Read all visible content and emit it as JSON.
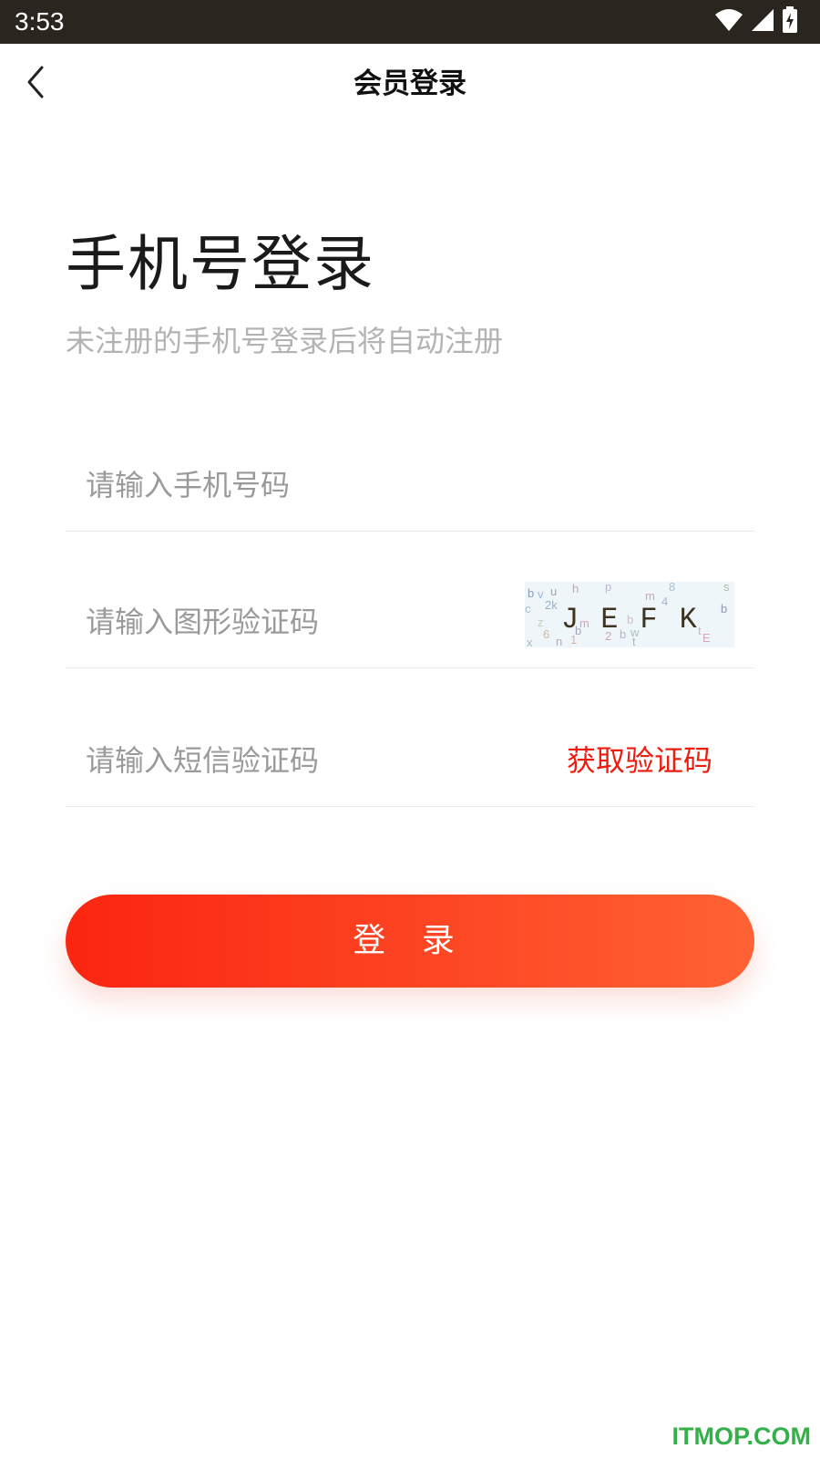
{
  "status_bar": {
    "time": "3:53",
    "icons": [
      "wifi-icon",
      "cellular-signal-icon",
      "battery-charging-icon"
    ]
  },
  "nav": {
    "back_icon": "chevron-left-icon",
    "title": "会员登录"
  },
  "heading": {
    "title": "手机号登录",
    "subtitle": "未注册的手机号登录后将自动注册"
  },
  "form": {
    "phone": {
      "placeholder": "请输入手机号码",
      "value": ""
    },
    "captcha": {
      "placeholder": "请输入图形验证码",
      "value": "",
      "image_text": "JEFK"
    },
    "sms": {
      "placeholder": "请输入短信验证码",
      "value": "",
      "get_code_label": "获取验证码"
    },
    "login_label": "登 录"
  },
  "watermark": "ITMOP.COM",
  "colors": {
    "accent": "#ec1c0e",
    "button_gradient_start": "#fb2510",
    "button_gradient_end": "#ff6234",
    "status_bar": "#2b251f",
    "placeholder": "#9a9a9a",
    "subtitle": "#b3b3b3",
    "watermark": "#34b04a"
  }
}
